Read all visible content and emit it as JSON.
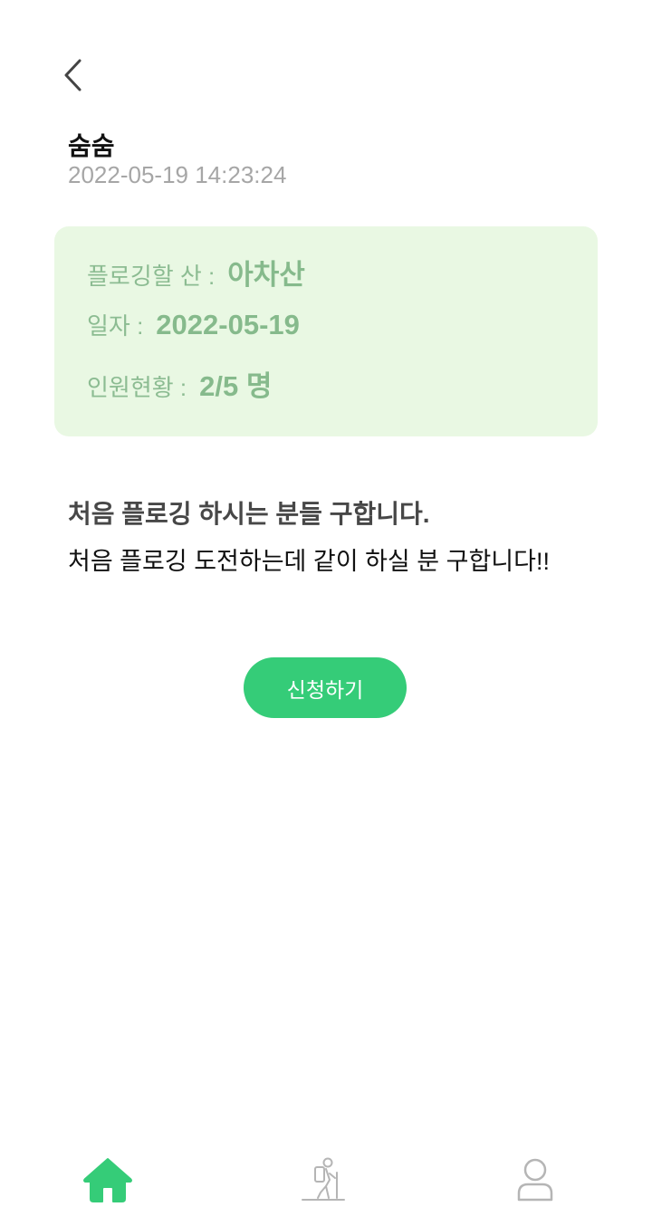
{
  "header": {
    "back_icon": "chevron-left-icon"
  },
  "post": {
    "author": "숨숨",
    "timestamp": "2022-05-19 14:23:24",
    "title": "처음 플로깅 하시는 분들 구합니다.",
    "body": "처음 플로깅 도전하는데 같이 하실 분 구합니다!!"
  },
  "info": {
    "mountain_label": "플로깅할 산 :",
    "mountain_value": "아차산",
    "date_label": "일자 :",
    "date_value": "2022-05-19",
    "members_label": "인원현황 :",
    "members_value": "2/5 명"
  },
  "actions": {
    "apply_label": "신청하기"
  },
  "nav": {
    "items": [
      {
        "icon": "home-icon",
        "active": true
      },
      {
        "icon": "hiker-icon",
        "active": false
      },
      {
        "icon": "profile-icon",
        "active": false
      }
    ]
  },
  "colors": {
    "accent": "#35cc78",
    "card_background": "#e9f8e3",
    "card_text": "#86ba8c",
    "timestamp": "#a6a6a6",
    "inactive_icon": "#b5b5b5"
  }
}
